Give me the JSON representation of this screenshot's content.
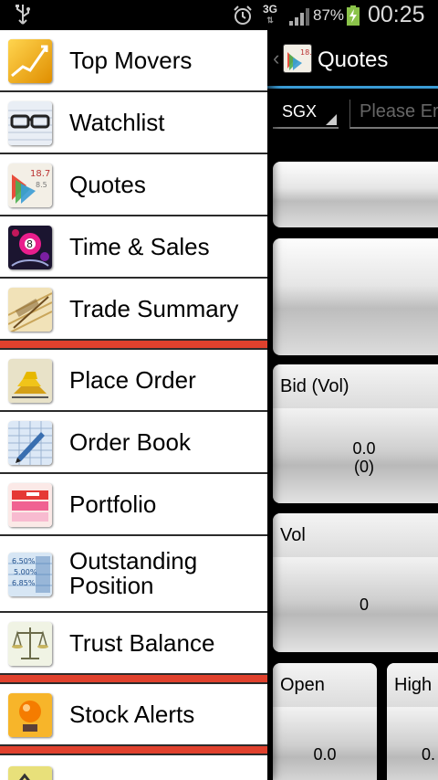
{
  "status_bar": {
    "usb_icon": "usb-icon",
    "alarm_icon": "alarm-icon",
    "network_type": "3G",
    "network_arrows": "⇅",
    "signal_icon": "signal-icon",
    "battery_percent": "87%",
    "battery_icon": "battery-charging-icon",
    "time": "00:25"
  },
  "colors": {
    "separator": "#e0412d",
    "accent_underline": "#3a9bd5"
  },
  "drawer": {
    "items": [
      {
        "label": "Top Movers",
        "icon": "top-movers-icon"
      },
      {
        "label": "Watchlist",
        "icon": "glasses-icon"
      },
      {
        "label": "Quotes",
        "icon": "quotes-icon"
      },
      {
        "label": "Time & Sales",
        "icon": "time-sales-icon"
      },
      {
        "label": "Trade Summary",
        "icon": "trade-summary-icon"
      },
      {
        "label": "Place Order",
        "icon": "gold-bars-icon"
      },
      {
        "label": "Order Book",
        "icon": "order-book-icon"
      },
      {
        "label": "Portfolio",
        "icon": "portfolio-icon"
      },
      {
        "label": "Outstanding Position",
        "icon": "outstanding-position-icon"
      },
      {
        "label": "Trust Balance",
        "icon": "scale-icon"
      },
      {
        "label": "Stock Alerts",
        "icon": "alert-icon"
      }
    ]
  },
  "quotes_panel": {
    "title": "Quotes",
    "exchange": "SGX",
    "search_placeholder": "Please Er",
    "bid": {
      "label": "Bid (Vol)",
      "price": "0.0",
      "volume": "(0)"
    },
    "vol": {
      "label": "Vol",
      "value": "0"
    },
    "open": {
      "label": "Open",
      "value": "0.0"
    },
    "high": {
      "label": "High",
      "value": "0."
    }
  }
}
